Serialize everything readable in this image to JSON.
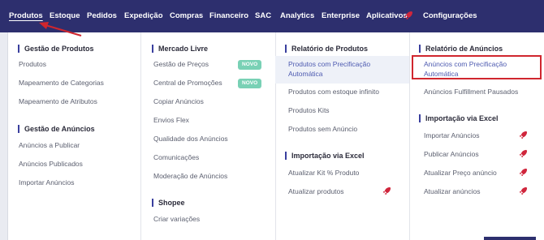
{
  "nav": {
    "items": [
      "Produtos",
      "Estoque",
      "Pedidos",
      "Expedição",
      "Compras",
      "Financeiro",
      "SAC",
      "Analytics",
      "Enterprise",
      "Aplicativos",
      "Configurações"
    ]
  },
  "col1": {
    "section1": "Gestão de Produtos",
    "links1": [
      "Produtos",
      "Mapeamento de Categorias",
      "Mapeamento de Atributos"
    ],
    "section2": "Gestão de Anúncios",
    "links2": [
      "Anúncios a Publicar",
      "Anúncios Publicados",
      "Importar Anúncios"
    ]
  },
  "col2": {
    "section1": "Mercado Livre",
    "links1": [
      "Gestão de Preços",
      "Central de Promoções",
      "Copiar Anúncios",
      "Envios Flex",
      "Qualidade dos Anúncios",
      "Comunicações",
      "Moderação de Anúncios"
    ],
    "badge": "NOVO",
    "section2": "Shopee",
    "links2": [
      "Criar variações"
    ]
  },
  "col3": {
    "section1": "Relatório de Produtos",
    "link_hl_1": "Produtos com Precificação",
    "link_hl_2": "Automática",
    "links1": [
      "Produtos com estoque infinito",
      "Produtos Kits",
      "Produtos sem Anúncio"
    ],
    "section2": "Importação via Excel",
    "links2": [
      "Atualizar Kit % Produto",
      "Atualizar produtos"
    ]
  },
  "col4": {
    "section1": "Relatório de Anúncios",
    "link_hl_1": "Anúncios com Precificação",
    "link_hl_2": "Automática",
    "links1": [
      "Anúncios Fulfillment Pausados"
    ],
    "section2": "Importação via Excel",
    "links2": [
      "Importar Anúncios",
      "Publicar Anúncios",
      "Atualizar Preço anúncio",
      "Atualizar anúncios"
    ]
  },
  "colors": {
    "nav_bg": "#2d2f6e",
    "accent": "#3a3f9e",
    "badge": "#79d1b5",
    "rocket": "#d0263c",
    "highlight_box": "#d0262e"
  },
  "icons": [
    "rocket-icon",
    "red-arrow"
  ]
}
